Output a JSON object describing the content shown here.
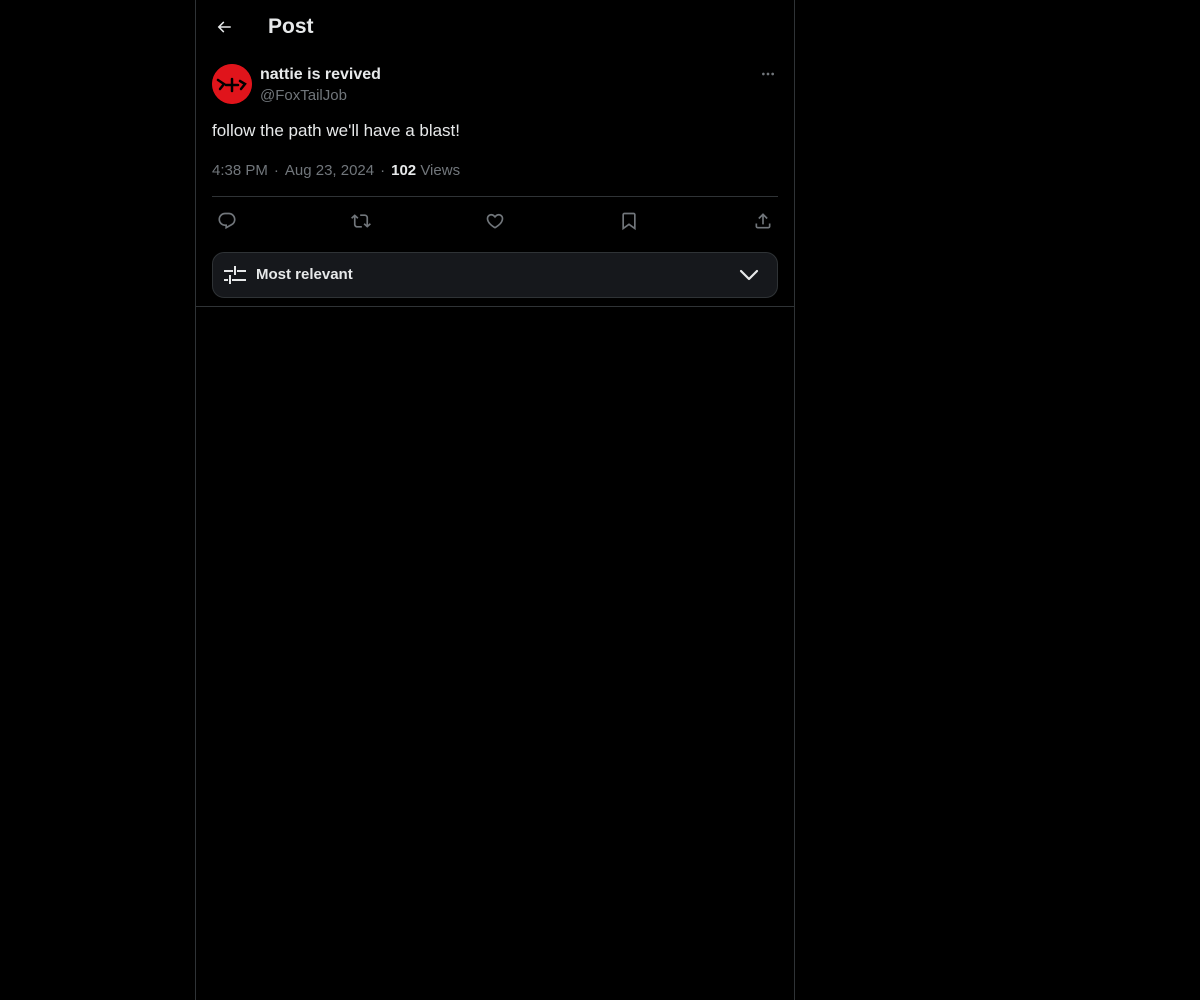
{
  "header": {
    "title": "Post",
    "back_icon": "arrow-left-icon"
  },
  "post": {
    "author": {
      "display_name": "nattie is revived",
      "handle": "@FoxTailJob",
      "avatar_color": "#e0141b"
    },
    "text": "follow the path we'll have a blast!",
    "time": "4:38 PM",
    "date": "Aug 23, 2024",
    "views_count": "102",
    "views_label": "Views",
    "separator": "·",
    "actions": [
      {
        "name": "reply",
        "icon": "reply-icon"
      },
      {
        "name": "repost",
        "icon": "repost-icon"
      },
      {
        "name": "like",
        "icon": "heart-icon"
      },
      {
        "name": "bookmark",
        "icon": "bookmark-icon"
      },
      {
        "name": "share",
        "icon": "share-icon"
      }
    ]
  },
  "replies_sort": {
    "selected": "Most relevant",
    "icon": "sliders-icon"
  },
  "colors": {
    "background": "#000000",
    "text_primary": "#e7e9ea",
    "text_secondary": "#71767b",
    "border": "#2f3336",
    "sort_bar_bg": "#16181c"
  }
}
